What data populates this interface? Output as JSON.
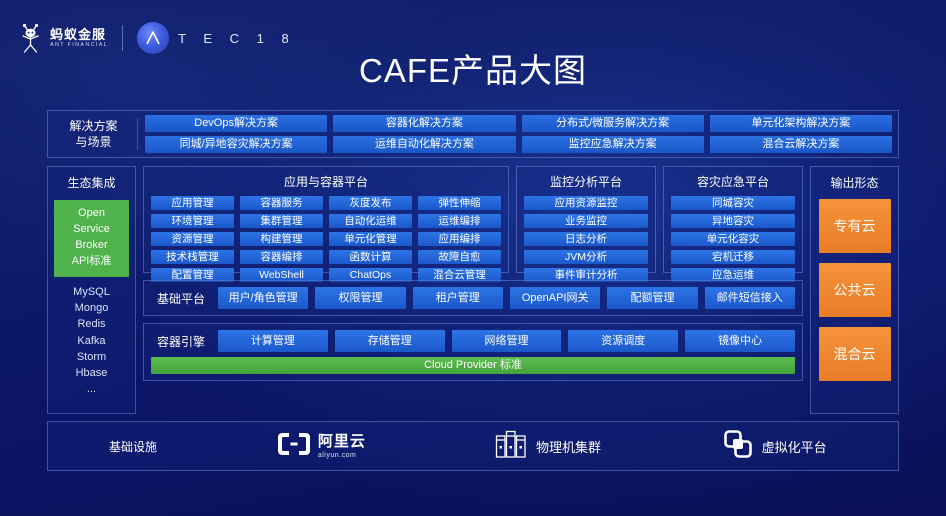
{
  "brand": {
    "ant_cn": "蚂蚁金服",
    "ant_en": "ANT FINANCIAL",
    "atec_text": "T E C   1 8",
    "ant_icon": "ant-financial-logo-icon",
    "atec_icon": "atec-a-badge-icon"
  },
  "title": "CAFE产品大图",
  "solutions": {
    "label": "解决方案\n与场景",
    "label_line1": "解决方案",
    "label_line2": "与场景",
    "row1": [
      "DevOps解决方案",
      "容器化解决方案",
      "分布式/微服务解决方案",
      "单元化架构解决方案"
    ],
    "row2": [
      "同城/异地容灾解决方案",
      "运维自动化解决方案",
      "监控应急解决方案",
      "混合云解决方案"
    ]
  },
  "eco": {
    "title": "生态集成",
    "highlight": [
      "Open",
      "Service",
      "Broker",
      "API标准"
    ],
    "highlight_color": "#4fb24b",
    "list": [
      "MySQL",
      "Mongo",
      "Redis",
      "Kafka",
      "Storm",
      "Hbase",
      "..."
    ]
  },
  "app_platform": {
    "title": "应用与容器平台",
    "cells": [
      "应用管理",
      "容器服务",
      "灰度发布",
      "弹性伸缩",
      "环境管理",
      "集群管理",
      "自动化运维",
      "运维编排",
      "资源管理",
      "构建管理",
      "单元化管理",
      "应用编排",
      "技术栈管理",
      "容器编排",
      "函数计算",
      "故障自愈",
      "配置管理",
      "WebShell",
      "ChatOps",
      "混合云管理"
    ]
  },
  "monitor_platform": {
    "title": "监控分析平台",
    "items": [
      "应用资源监控",
      "业务监控",
      "日志分析",
      "JVM分析",
      "事件审计分析"
    ]
  },
  "dr_platform": {
    "title": "容灾应急平台",
    "items": [
      "同城容灾",
      "异地容灾",
      "单元化容灾",
      "宕机迁移",
      "应急运维"
    ]
  },
  "base_platform": {
    "label": "基础平台",
    "items": [
      "用户/角色管理",
      "权限管理",
      "租户管理",
      "OpenAPI网关",
      "配额管理",
      "邮件短信接入"
    ]
  },
  "container_engine": {
    "label": "容器引擎",
    "items": [
      "计算管理",
      "存储管理",
      "网络管理",
      "资源调度",
      "镜像中心"
    ],
    "cloud_provider": "Cloud Provider 标准",
    "cloud_provider_color": "#4fb24b"
  },
  "output": {
    "title": "输出形态",
    "boxes": [
      "专有云",
      "公共云",
      "混合云"
    ],
    "box_color": "#ee8330"
  },
  "infra": {
    "label": "基础设施",
    "items": [
      {
        "name": "阿里云",
        "sub": "aliyun.com",
        "icon": "aliyun-logo-icon"
      },
      {
        "name": "物理机集群",
        "sub": "",
        "icon": "server-rack-icon"
      },
      {
        "name": "虚拟化平台",
        "sub": "",
        "icon": "vmware-squares-icon"
      }
    ]
  },
  "colors": {
    "background": "#0c1668",
    "chip_blue": "#2a6fe0",
    "accent_green": "#4fb24b",
    "accent_orange": "#ee8330"
  }
}
